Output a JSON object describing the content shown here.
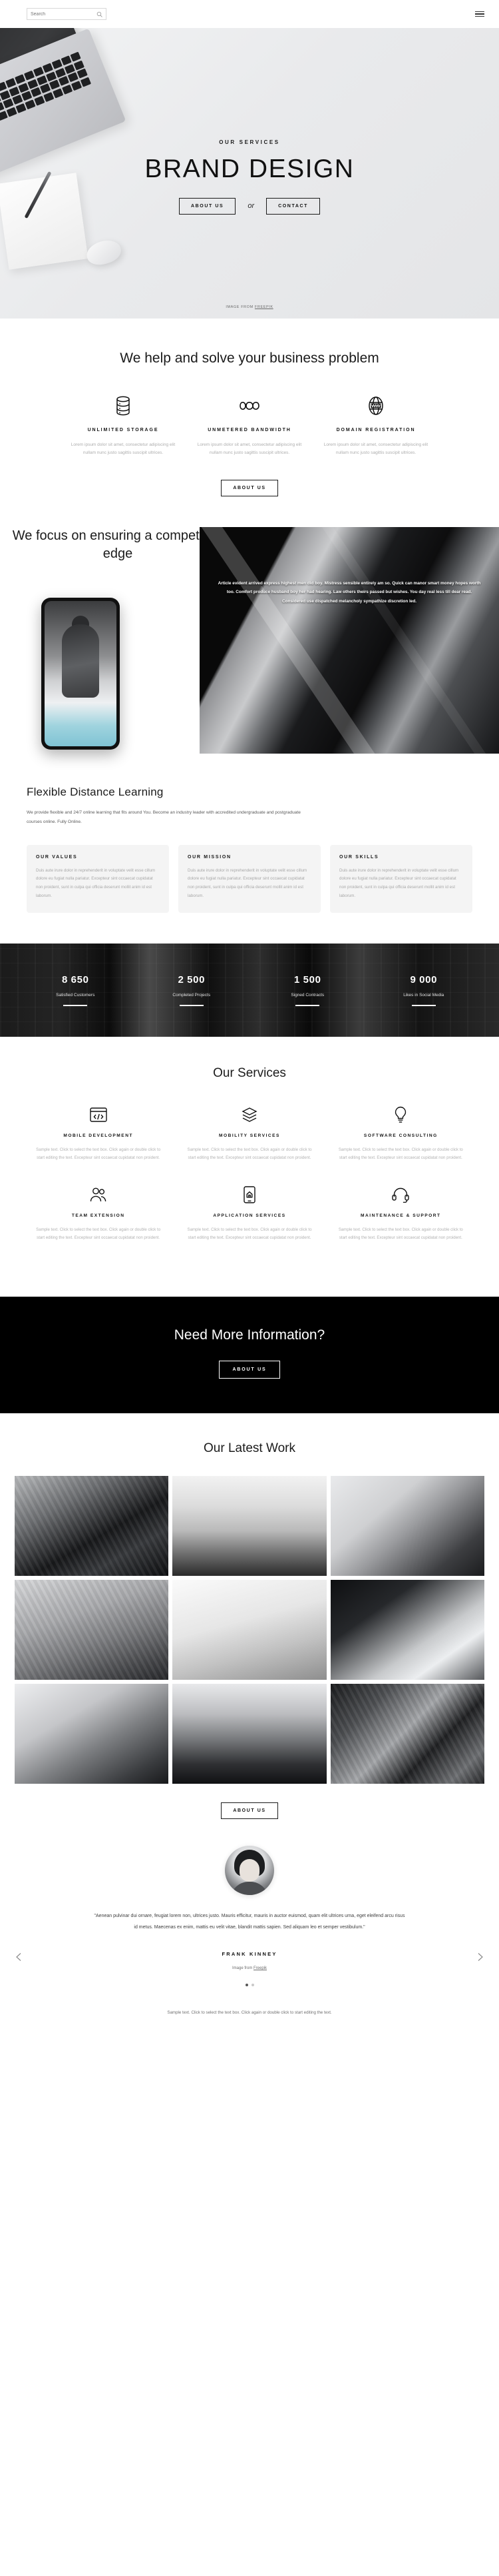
{
  "topbar": {
    "search_value": "",
    "search_placeholder": "Search",
    "search_icon": "search-icon",
    "menu_icon": "hamburger-menu-icon"
  },
  "hero": {
    "eyebrow": "OUR SERVICES",
    "title": "BRAND DESIGN",
    "btn_primary": "ABOUT US",
    "separator": "or",
    "btn_secondary": "CONTACT",
    "credit_prefix": "IMAGE FROM ",
    "credit_link": "FREEPIK"
  },
  "help": {
    "title": "We help and solve your business problem",
    "button": "ABOUT US",
    "features": [
      {
        "icon": "database-icon",
        "name": "UNLIMITED STORAGE",
        "desc": "Lorem ipsum dolor sit amet, consectetur adipiscing elit nullam nunc justo sagittis suscipit ultrices."
      },
      {
        "icon": "infinity-icon",
        "name": "UNMETERED BANDWIDTH",
        "desc": "Lorem ipsum dolor sit amet, consectetur adipiscing elit nullam nunc justo sagittis suscipit ultrices."
      },
      {
        "icon": "globe-icon",
        "name": "DOMAIN REGISTRATION",
        "desc": "Lorem ipsum dolor sit amet, consectetur adipiscing elit nullam nunc justo sagittis suscipit ultrices."
      }
    ]
  },
  "focus": {
    "title": "We focus on ensuring a competitive edge",
    "caption": "Article evident arrived express highest men did boy. Mistress sensible entirely am so. Quick can manor smart money hopes worth too. Comfort produce husband boy her had hearing. Law others theirs passed but wishes. You day real less till dear read. Considered use dispatched melancholy sympathize discretion led."
  },
  "learning": {
    "title": "Flexible Distance Learning",
    "subtitle": "We provide flexible and 24/7 online learning that fits around You. Become an industry leader with accredited undergraduate and postgraduate courses online. Fully Online.",
    "cards": [
      {
        "title": "OUR VALUES",
        "text": "Duis aute irure dolor in reprehenderit in voluptate velit esse cillum dolore eu fugiat nulla pariatur. Excepteur sint occaecat cupidatat non proident, sunt in culpa qui officia deserunt mollit anim id est laborum."
      },
      {
        "title": "OUR MISSION",
        "text": "Duis aute irure dolor in reprehenderit in voluptate velit esse cillum dolore eu fugiat nulla pariatur. Excepteur sint occaecat cupidatat non proident, sunt in culpa qui officia deserunt mollit anim id est laborum."
      },
      {
        "title": "OUR SKILLS",
        "text": "Duis aute irure dolor in reprehenderit in voluptate velit esse cillum dolore eu fugiat nulla pariatur. Excepteur sint occaecat cupidatat non proident, sunt in culpa qui officia deserunt mollit anim id est laborum."
      }
    ]
  },
  "stats": [
    {
      "number": "8 650",
      "label": "Satisfied Customers"
    },
    {
      "number": "2 500",
      "label": "Completed Projects"
    },
    {
      "number": "1 500",
      "label": "Signed Contracts"
    },
    {
      "number": "9 000",
      "label": "Likes in Social Media"
    }
  ],
  "services": {
    "title": "Our Services",
    "items": [
      {
        "icon": "code-window-icon",
        "name": "MOBILE DEVELOPMENT",
        "text": "Sample text. Click to select the text box. Click again or double click to start editing the text. Excepteur sint occaecat cupidatat non proident."
      },
      {
        "icon": "layers-icon",
        "name": "MOBILITY SERVICES",
        "text": "Sample text. Click to select the text box. Click again or double click to start editing the text. Excepteur sint occaecat cupidatat non proident."
      },
      {
        "icon": "lightbulb-gear-icon",
        "name": "SOFTWARE CONSULTING",
        "text": "Sample text. Click to select the text box. Click again or double click to start editing the text. Excepteur sint occaecat cupidatat non proident."
      },
      {
        "icon": "people-group-icon",
        "name": "TEAM EXTENSION",
        "text": "Sample text. Click to select the text box. Click again or double click to start editing the text. Excepteur sint occaecat cupidatat non proident."
      },
      {
        "icon": "mobile-app-icon",
        "name": "APPLICATION SERVICES",
        "text": "Sample text. Click to select the text box. Click again or double click to start editing the text. Excepteur sint occaecat cupidatat non proident."
      },
      {
        "icon": "headset-support-icon",
        "name": "MAINTENANCE & SUPPORT",
        "text": "Sample text. Click to select the text box. Click again or double click to start editing the text. Excepteur sint occaecat cupidatat non proident."
      }
    ]
  },
  "cta": {
    "title": "Need More Information?",
    "button": "ABOUT US"
  },
  "work": {
    "title": "Our Latest Work",
    "button": "ABOUT US",
    "tiles": [
      "portfolio-image-1",
      "portfolio-image-2",
      "portfolio-image-3",
      "portfolio-image-4",
      "portfolio-image-5",
      "portfolio-image-6",
      "portfolio-image-7",
      "portfolio-image-8",
      "portfolio-image-9"
    ]
  },
  "testimonial": {
    "quote": "\"Aenean pulvinar dui ornare, feugiat lorem non, ultrices justo. Mauris efficitur, mauris in auctor euismod, quam elit ultrices urna, eget eleifend arcu risus id metus. Maecenas ex enim, mattis eu velit vitae, blandit mattis sapien. Sed aliquam leo et semper vestibulum.\"",
    "author": "FRANK KINNEY",
    "credit_prefix": "Image from ",
    "credit_link": "Freepik",
    "prev_icon": "chevron-left-icon",
    "next_icon": "chevron-right-icon",
    "dots": 2,
    "active_dot": 0
  },
  "footer": {
    "text": "Sample text. Click to select the text box. Click again or double click to start editing the text."
  },
  "colors": {
    "accent": "#000000",
    "muted": "#b2b2b2",
    "card_bg": "#f4f4f4"
  }
}
